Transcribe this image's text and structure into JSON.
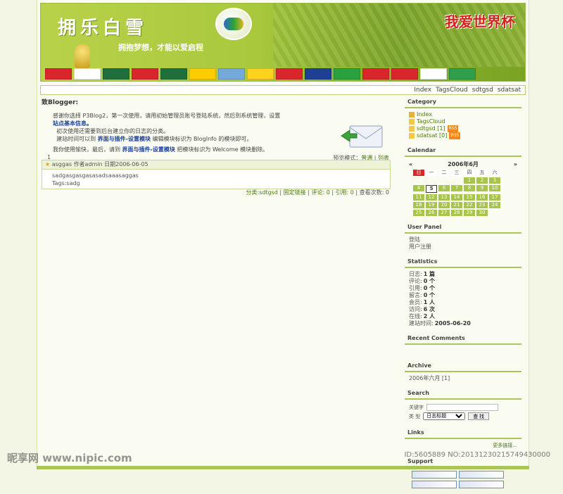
{
  "banner": {
    "logo_text": "拥乐白雪",
    "slogan": "拥抱梦想，才能以爱启程",
    "title_cn": "我爱世界杯",
    "flag_colors": [
      "#d9262a",
      "#ffffff",
      "#1f6f3a",
      "#d9262a",
      "#1f6f3a",
      "#ffcc00",
      "#76a9db",
      "#ffd21f",
      "#d9262a",
      "#1d3f94",
      "#27a23c",
      "#d9262a",
      "#d9262a",
      "#ffffff",
      "#2f9f4a"
    ]
  },
  "nav": [
    "Index",
    "TagsCloud",
    "sdtgsd",
    "sdatsat"
  ],
  "main": {
    "greeting": "致Blogger:",
    "line1": "感谢你选择 P3Blog2，第一次使用，请用初始管理员账号登陆系统，然后到系统管理，设置",
    "line1b": "站点基本信息。",
    "line2": "初次使用还需要到后台建立你的日志的分类。",
    "line3a": "建站时间可以到",
    "line3b": "界面与插件-设置模块",
    "line3c": "编辑模块标识为 BlogInfo 的模块即可。",
    "line4a": "我你使用愉快，最后，请到",
    "line4b": "界面与插件-设置模块",
    "line4c": "把模块标识为 Welcome 模块删除。",
    "page_num": "1",
    "mode_label": "预览模式：",
    "mode_normal": "普通",
    "mode_list": "列表",
    "post": {
      "title": "asggas",
      "meta": "作者admin 日期2006-06-05",
      "body": "sadgasgasgasasadsaaasaggas",
      "tags": "Tags:sadg"
    },
    "footer": {
      "category": "分类:sdtgsd",
      "permalink": "固定链接",
      "comments": "评论: 0",
      "trackbacks": "引用: 0",
      "views": "查看次数: 0"
    }
  },
  "sidebar": {
    "category_title": "Category",
    "categories": [
      "Index",
      "TagsCloud",
      "sdtgsd [1]",
      "sdatsat [0]"
    ],
    "rss_label": "RSS",
    "calendar_title": "Calendar",
    "cal_prev": "«",
    "cal_month": "2006年6月",
    "cal_next": "»",
    "weekdays": [
      "日",
      "一",
      "二",
      "三",
      "四",
      "五",
      "六"
    ],
    "days": [
      "",
      "",
      "",
      "",
      "1",
      "2",
      "3",
      "4",
      "5",
      "6",
      "7",
      "8",
      "9",
      "10",
      "11",
      "12",
      "13",
      "14",
      "15",
      "16",
      "17",
      "18",
      "19",
      "20",
      "21",
      "22",
      "23",
      "24",
      "25",
      "26",
      "27",
      "28",
      "29",
      "30",
      ""
    ],
    "today": "5",
    "user_panel_title": "User Panel",
    "login": "登陆",
    "register": "用户注册",
    "stats_title": "Statistics",
    "stats": [
      {
        "label": "日志:",
        "value": "1 篇"
      },
      {
        "label": "评论:",
        "value": "0 个"
      },
      {
        "label": "引用:",
        "value": "0 个"
      },
      {
        "label": "留言:",
        "value": "0 个"
      },
      {
        "label": "会员:",
        "value": "1 人"
      },
      {
        "label": "访问:",
        "value": "6 次"
      },
      {
        "label": "在线:",
        "value": "2 人"
      },
      {
        "label": "建站时间:",
        "value": "2005-06-20"
      }
    ],
    "recent_comments_title": "Recent Comments",
    "archive_title": "Archive",
    "archive_item": "2006年六月 [1]",
    "search_title": "Search",
    "keyword_label": "关键字",
    "type_label": "类 型",
    "type_value": "日志标题",
    "search_button": "查 找",
    "links_title": "Links",
    "more_links": "更多链接...",
    "support_title": "Support"
  },
  "watermark": {
    "site": "昵享网 www.nipic.com",
    "id": "ID:5605889 NO:20131230215749430000"
  }
}
